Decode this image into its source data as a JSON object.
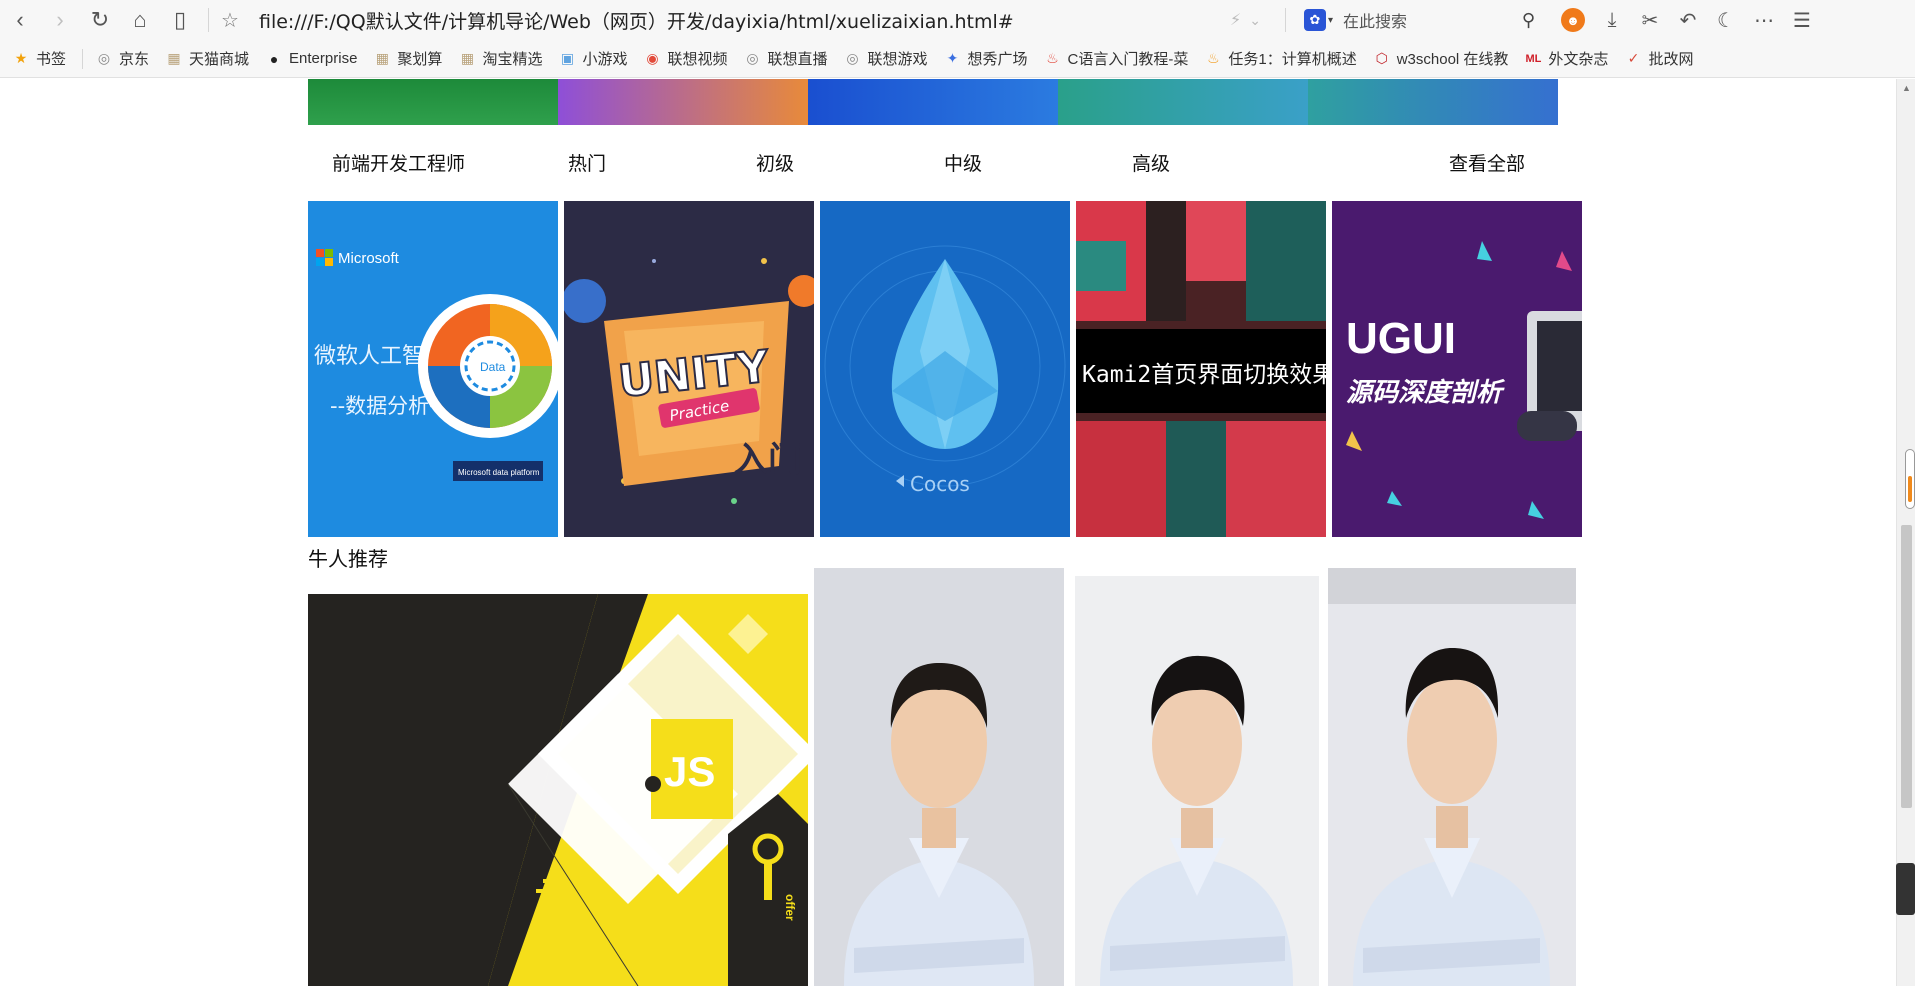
{
  "browser": {
    "url": "file:///F:/QQ默认文件/计算机导论/Web（网页）开发/dayixia/html/xuelizaixian.html#",
    "search_placeholder": "在此搜索"
  },
  "bookmarks": [
    {
      "label": "书签",
      "icon": "star-icon",
      "color": "#f2a20c"
    },
    {
      "label": "京东",
      "icon": "globe-icon",
      "color": "#888888"
    },
    {
      "label": "天猫商城",
      "icon": "image-icon",
      "color": "#b9a37c"
    },
    {
      "label": "Enterprise",
      "icon": "github-icon",
      "color": "#222222"
    },
    {
      "label": "聚划算",
      "icon": "image-icon",
      "color": "#b9a37c"
    },
    {
      "label": "淘宝精选",
      "icon": "image-icon",
      "color": "#b9a37c"
    },
    {
      "label": "小游戏",
      "icon": "game-icon",
      "color": "#5fa3e0"
    },
    {
      "label": "联想视频",
      "icon": "video-icon",
      "color": "#e24a3a"
    },
    {
      "label": "联想直播",
      "icon": "globe-icon",
      "color": "#888888"
    },
    {
      "label": "联想游戏",
      "icon": "globe-icon",
      "color": "#888888"
    },
    {
      "label": "想秀广场",
      "icon": "sparkle-icon",
      "color": "#3b6fe0"
    },
    {
      "label": "C语言入门教程-菜",
      "icon": "flame-icon",
      "color": "#e2463a"
    },
    {
      "label": "任务1：计算机概述",
      "icon": "fire-icon",
      "color": "#f29b1c"
    },
    {
      "label": "w3school 在线教",
      "icon": "w3-icon",
      "color": "#c1272d"
    },
    {
      "label": "外文杂志",
      "icon": "ml-icon",
      "color": "#d0202a"
    },
    {
      "label": "批改网",
      "icon": "check-icon",
      "color": "#d84a3a"
    }
  ],
  "tabs": [
    {
      "label": "前端开发工程师"
    },
    {
      "label": "热门"
    },
    {
      "label": "初级"
    },
    {
      "label": "中级"
    },
    {
      "label": "高级"
    },
    {
      "label": "查看全部"
    }
  ],
  "courses": [
    {
      "brand": "Microsoft",
      "line1": "微软人工智能",
      "line2": "--数据分析平台",
      "center": "Data",
      "footer": "Microsoft data platform"
    },
    {
      "title": "UNITY",
      "sub": "Practice",
      "tag": "入门"
    },
    {
      "title": "Cocos"
    },
    {
      "title": "Kami2首页界面切换效果"
    },
    {
      "title": "UGUI",
      "sub": "源码深度剖析"
    }
  ],
  "section": {
    "title": "牛人推荐"
  },
  "featured": {
    "badge": "JS",
    "side": "offer"
  },
  "colors": {
    "accent_orange": "#f07a1a",
    "brand_blue": "#1a86e0",
    "js_yellow": "#f5de1a"
  }
}
